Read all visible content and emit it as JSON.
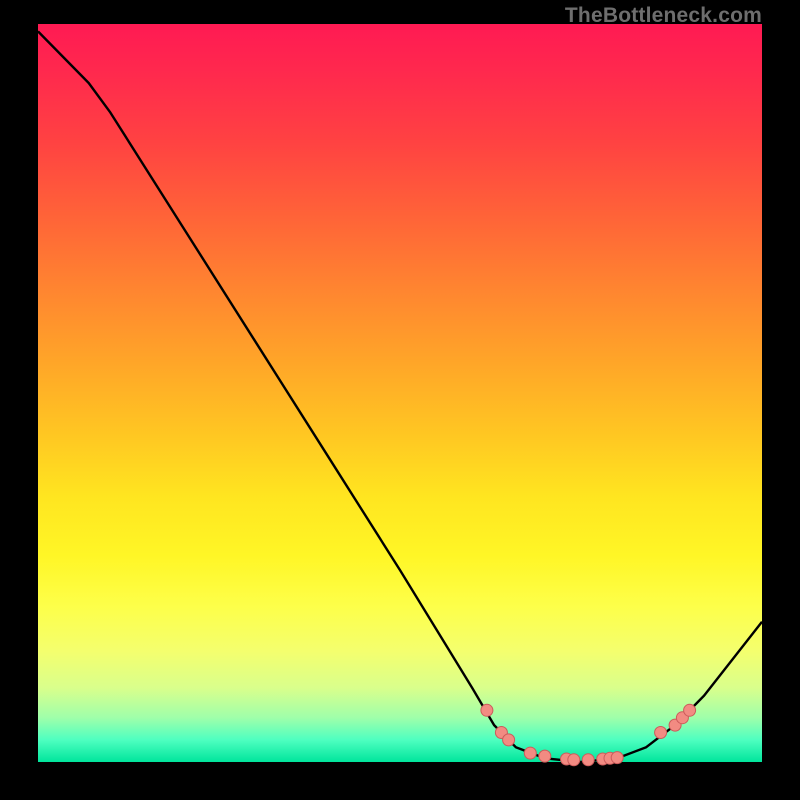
{
  "watermark": "TheBottleneck.com",
  "colors": {
    "line": "#000000",
    "marker_fill": "#f28b82",
    "marker_stroke": "#cc5b5b",
    "frame": "#000000"
  },
  "chart_data": {
    "type": "line",
    "title": "",
    "xlabel": "",
    "ylabel": "",
    "xlim": [
      0,
      100
    ],
    "ylim": [
      0,
      100
    ],
    "curve": [
      {
        "x": 0,
        "y": 99
      },
      {
        "x": 7,
        "y": 92
      },
      {
        "x": 10,
        "y": 88
      },
      {
        "x": 20,
        "y": 72.5
      },
      {
        "x": 30,
        "y": 57
      },
      {
        "x": 40,
        "y": 41.5
      },
      {
        "x": 50,
        "y": 26
      },
      {
        "x": 60,
        "y": 10
      },
      {
        "x": 63,
        "y": 5
      },
      {
        "x": 66,
        "y": 2
      },
      {
        "x": 70,
        "y": 0.5
      },
      {
        "x": 75,
        "y": 0
      },
      {
        "x": 80,
        "y": 0.5
      },
      {
        "x": 84,
        "y": 2
      },
      {
        "x": 88,
        "y": 5
      },
      {
        "x": 92,
        "y": 9
      },
      {
        "x": 96,
        "y": 14
      },
      {
        "x": 100,
        "y": 19
      }
    ],
    "markers": [
      {
        "x": 62,
        "y": 7
      },
      {
        "x": 64,
        "y": 4
      },
      {
        "x": 65,
        "y": 3
      },
      {
        "x": 68,
        "y": 1.2
      },
      {
        "x": 70,
        "y": 0.8
      },
      {
        "x": 73,
        "y": 0.4
      },
      {
        "x": 74,
        "y": 0.3
      },
      {
        "x": 76,
        "y": 0.3
      },
      {
        "x": 78,
        "y": 0.4
      },
      {
        "x": 79,
        "y": 0.5
      },
      {
        "x": 80,
        "y": 0.6
      },
      {
        "x": 86,
        "y": 4
      },
      {
        "x": 88,
        "y": 5
      },
      {
        "x": 89,
        "y": 6
      },
      {
        "x": 90,
        "y": 7
      }
    ]
  }
}
